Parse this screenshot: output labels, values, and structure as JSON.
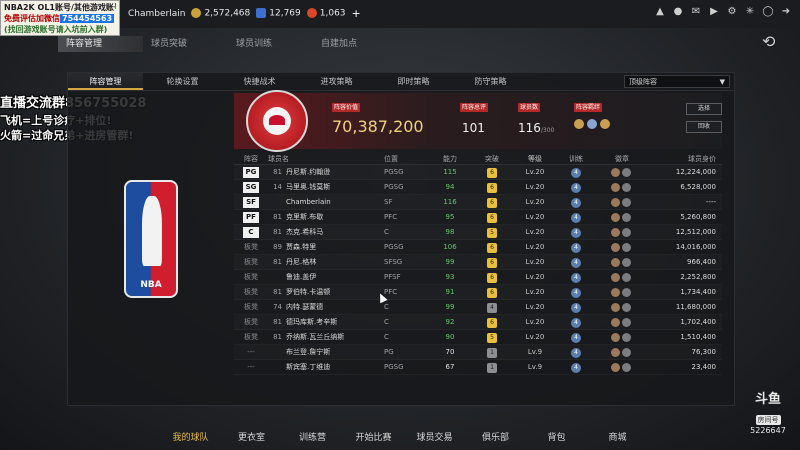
{
  "overlay_box": {
    "line1": "NBA2K OL1账号/其他游戏账号",
    "line2_prefix": "免费评估加微信",
    "line2_highlight": "754454563",
    "line3": "(找回游戏账号请入坑前入群)"
  },
  "player": {
    "name": "Chamberlain",
    "gold": "2,572,468",
    "points": "12,769",
    "coins": "1,063",
    "plus": "+"
  },
  "main_tabs": [
    "阵容管理",
    "球员突破",
    "球员训练",
    "自建加点"
  ],
  "sub_tabs": [
    "阵容管理",
    "轮换设置",
    "快捷战术",
    "进攻策略",
    "即时策略",
    "防守策略"
  ],
  "lineup_select": "顶级阵容",
  "team": {
    "value_label": "阵容价值",
    "value": "70,387,200",
    "rating_label": "阵容总评",
    "rating": "101",
    "count_label": "球员数",
    "count": "116",
    "count_max": "/300",
    "chem_label": "阵容羁绊",
    "btn_select": "选择",
    "btn_recycle": "回收"
  },
  "table": {
    "headers": [
      "阵容",
      "球员名",
      "位置",
      "能力",
      "突破",
      "等级",
      "训练",
      "徽章",
      "球员身价"
    ],
    "rows": [
      {
        "pos": "PG",
        "num": "81",
        "name": "丹尼斯.约翰逊",
        "slot": "PGSG",
        "ovr": "115",
        "up": "6",
        "lv": "Lv.20",
        "train": "4",
        "salary": "12,224,000"
      },
      {
        "pos": "SG",
        "num": "14",
        "name": "马里奥.钱莫斯",
        "slot": "PGSG",
        "ovr": "94",
        "up": "6",
        "lv": "Lv.20",
        "train": "4",
        "salary": "6,528,000"
      },
      {
        "pos": "SF",
        "num": "",
        "name": "Chamberlain",
        "slot": "SF",
        "ovr": "116",
        "up": "6",
        "lv": "Lv.20",
        "train": "4",
        "salary": "----"
      },
      {
        "pos": "PF",
        "num": "81",
        "name": "克里斯.布歇",
        "slot": "PFC",
        "ovr": "95",
        "up": "6",
        "lv": "Lv.20",
        "train": "4",
        "salary": "5,260,800"
      },
      {
        "pos": "C",
        "num": "81",
        "name": "杰克.希科马",
        "slot": "C",
        "ovr": "98",
        "up": "5",
        "lv": "Lv.20",
        "train": "4",
        "salary": "12,512,000"
      },
      {
        "pos": "板凳",
        "num": "89",
        "name": "贾森.特里",
        "slot": "PGSG",
        "ovr": "106",
        "up": "6",
        "lv": "Lv.20",
        "train": "4",
        "salary": "14,016,000"
      },
      {
        "pos": "板凳",
        "num": "81",
        "name": "丹尼.格林",
        "slot": "SFSG",
        "ovr": "99",
        "up": "6",
        "lv": "Lv.20",
        "train": "4",
        "salary": "966,400"
      },
      {
        "pos": "板凳",
        "num": "",
        "name": "鲁迪.盖伊",
        "slot": "PFSF",
        "ovr": "93",
        "up": "6",
        "lv": "Lv.20",
        "train": "4",
        "salary": "2,252,800"
      },
      {
        "pos": "板凳",
        "num": "81",
        "name": "罗伯特.卡温顿",
        "slot": "PFC",
        "ovr": "91",
        "up": "6",
        "lv": "Lv.20",
        "train": "4",
        "salary": "1,734,400"
      },
      {
        "pos": "板凳",
        "num": "74",
        "name": "内特.瑟蒙德",
        "slot": "C",
        "ovr": "99",
        "up": "4",
        "lv": "Lv.20",
        "train": "4",
        "salary": "11,680,000"
      },
      {
        "pos": "板凳",
        "num": "81",
        "name": "德玛库斯.考辛斯",
        "slot": "C",
        "ovr": "92",
        "up": "6",
        "lv": "Lv.20",
        "train": "4",
        "salary": "1,702,400"
      },
      {
        "pos": "板凳",
        "num": "81",
        "name": "乔纳斯.瓦兰丘纳斯",
        "slot": "C",
        "ovr": "90",
        "up": "5",
        "lv": "Lv.20",
        "train": "4",
        "salary": "1,510,400"
      },
      {
        "pos": "---",
        "num": "",
        "name": "布兰登.詹宁斯",
        "slot": "PG",
        "ovr": "70",
        "up": "1",
        "lv": "Lv.9",
        "train": "4",
        "salary": "76,300"
      },
      {
        "pos": "---",
        "num": "",
        "name": "斯宾塞.丁维迪",
        "slot": "PGSG",
        "ovr": "67",
        "up": "1",
        "lv": "Lv.9",
        "train": "4",
        "salary": "23,400"
      }
    ]
  },
  "overlay_text": {
    "line1": "直播交流群856755028",
    "line2": "飞机=上号诊疗+排位!",
    "line3": "火箭=过命兄弟+进房管群!"
  },
  "nba_logo_text": "NBA",
  "bottom_nav": [
    "我的球队",
    "更衣室",
    "训练营",
    "开始比赛",
    "球员交易",
    "俱乐部",
    "背包",
    "商城"
  ],
  "douyu": {
    "brand": "斗鱼",
    "label": "房间号",
    "room": "5226647"
  },
  "colors": {
    "accent_gold": "#e8b847",
    "team_red": "#c8102e",
    "ovr_green": "#61c96a"
  }
}
